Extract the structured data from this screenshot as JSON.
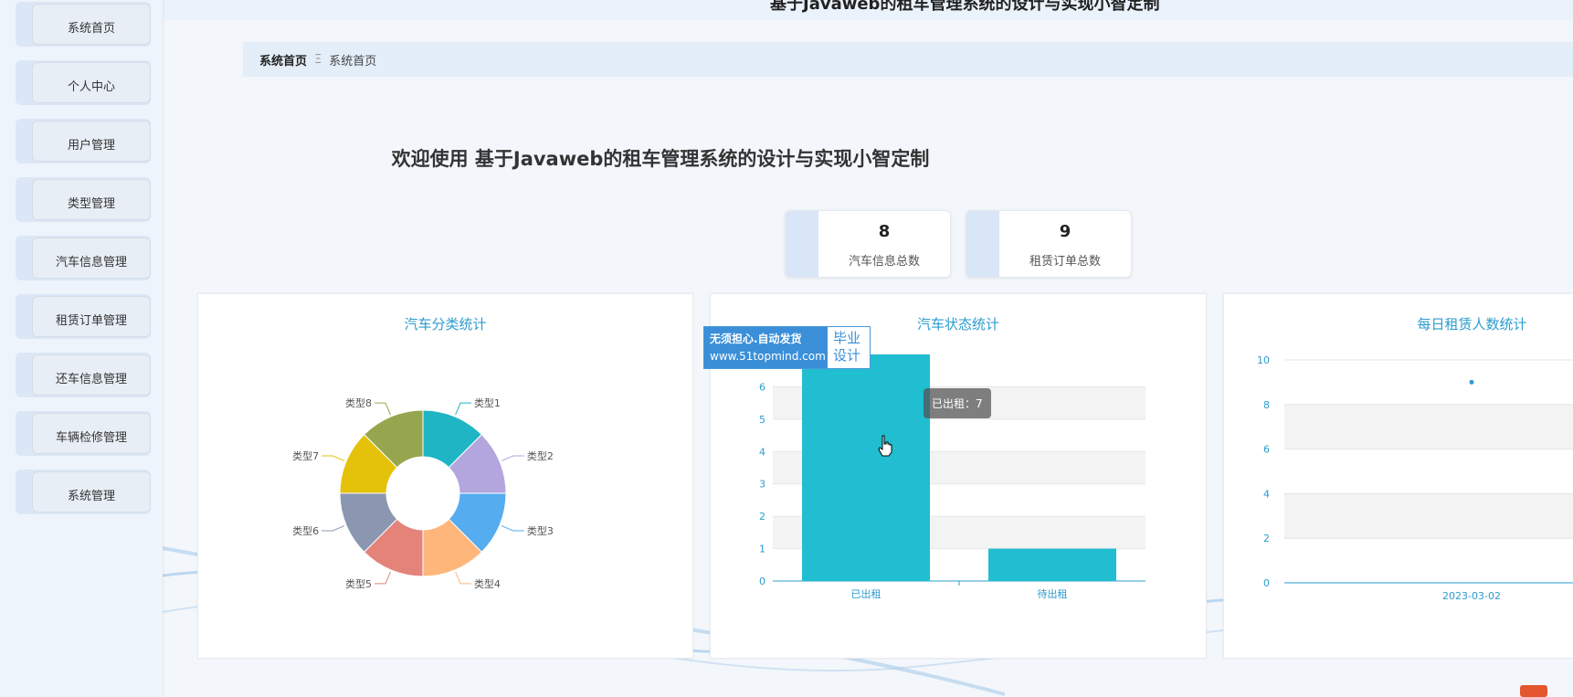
{
  "sidebar": {
    "items": [
      {
        "label": "系统首页"
      },
      {
        "label": "个人中心"
      },
      {
        "label": "用户管理"
      },
      {
        "label": "类型管理"
      },
      {
        "label": "汽车信息管理"
      },
      {
        "label": "租赁订单管理"
      },
      {
        "label": "还车信息管理"
      },
      {
        "label": "车辆检修管理"
      },
      {
        "label": "系统管理"
      }
    ]
  },
  "header": {
    "title": "基于Javaweb的租车管理系统的设计与实现小智定制"
  },
  "breadcrumb": {
    "home": "系统首页",
    "separator": "Ξ",
    "current": "系统首页"
  },
  "welcome": "欢迎使用 基于Javaweb的租车管理系统的设计与实现小智定制",
  "stats": [
    {
      "value": "8",
      "label": "汽车信息总数"
    },
    {
      "value": "9",
      "label": "租赁订单总数"
    }
  ],
  "watermark": {
    "line1": "无须担心.自动发货",
    "line2": "www.51topmind.com",
    "right1": "毕业",
    "right2": "设计"
  },
  "tooltip": "已出租：7",
  "colors": {
    "accent": "#2c9cd0",
    "bar": "#21bdd0"
  },
  "chart_data": [
    {
      "type": "pie",
      "title": "汽车分类统计",
      "categories": [
        "类型1",
        "类型2",
        "类型3",
        "类型4",
        "类型5",
        "类型6",
        "类型7",
        "类型8"
      ],
      "values": [
        1,
        1,
        1,
        1,
        1,
        1,
        1,
        1
      ],
      "colors": [
        "#1fb5c4",
        "#b3a5dd",
        "#55acef",
        "#ffb67a",
        "#e4837a",
        "#8b97b1",
        "#e5c20a",
        "#95a64e"
      ],
      "donut": true
    },
    {
      "type": "bar",
      "title": "汽车状态统计",
      "categories": [
        "已出租",
        "待出租"
      ],
      "values": [
        7,
        1
      ],
      "ylim": [
        0,
        7
      ],
      "yticks": [
        0,
        1,
        2,
        3,
        4,
        5,
        6
      ]
    },
    {
      "type": "scatter",
      "title": "每日租赁人数统计",
      "x": [
        "2023-03-02"
      ],
      "values": [
        9
      ],
      "ylim": [
        0,
        10
      ],
      "yticks": [
        0,
        2,
        4,
        6,
        8,
        10
      ]
    }
  ]
}
